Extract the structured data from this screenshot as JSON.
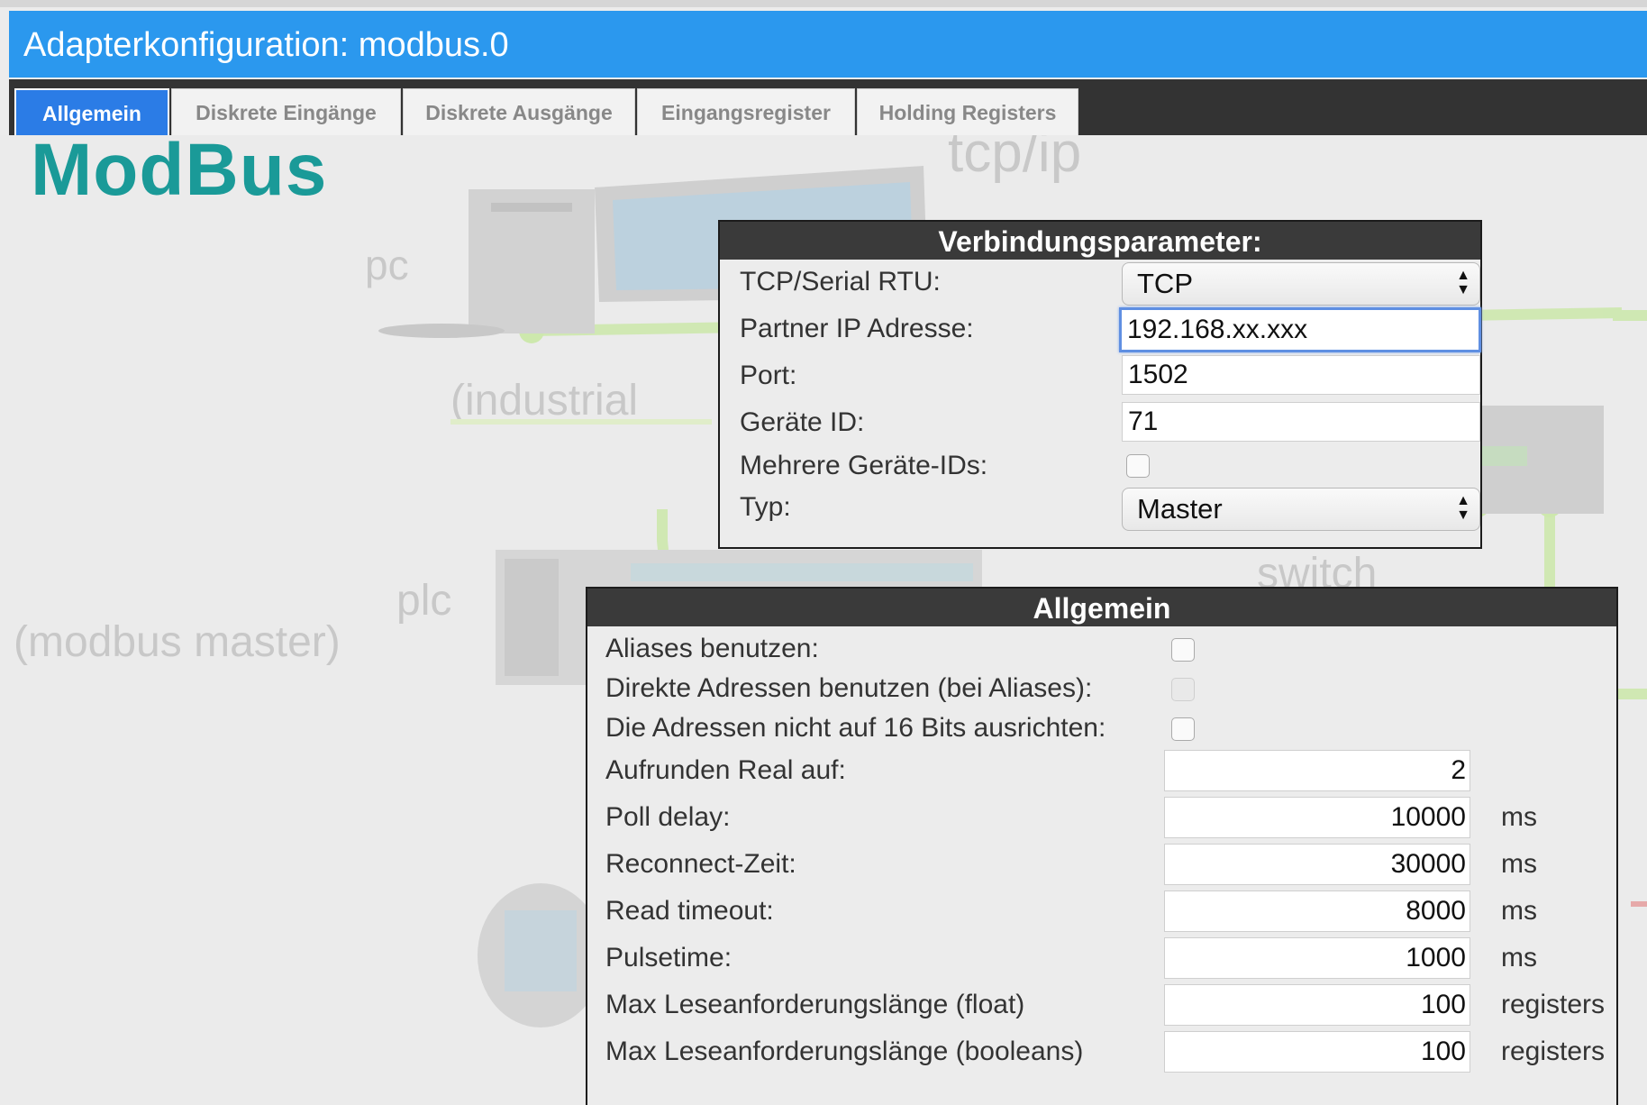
{
  "window": {
    "title": "Adapterkonfiguration: modbus.0"
  },
  "tabs": [
    {
      "label": "Allgemein",
      "active": true
    },
    {
      "label": "Diskrete Eingänge",
      "active": false
    },
    {
      "label": "Diskrete Ausgänge",
      "active": false
    },
    {
      "label": "Eingangsregister",
      "active": false
    },
    {
      "label": "Holding Registers",
      "active": false
    }
  ],
  "background": {
    "brand": "ModBus",
    "labels": {
      "tcpip": "tcp/ip",
      "pc": "pc",
      "industrial": "(industrial",
      "plc": "plc",
      "modbus_master": "(modbus master)",
      "switch": "switch"
    },
    "colors": {
      "brand": "#1a9a98",
      "network_line": "#c8e5a8"
    }
  },
  "connection": {
    "title": "Verbindungsparameter:",
    "mode": {
      "label": "TCP/Serial RTU:",
      "value": "TCP"
    },
    "ip": {
      "label": "Partner IP Adresse:",
      "value": "192.168.xx.xxx"
    },
    "port": {
      "label": "Port:",
      "value": "1502"
    },
    "device_id": {
      "label": "Geräte ID:",
      "value": "71"
    },
    "multi_ids": {
      "label": "Mehrere Geräte-IDs:",
      "checked": false
    },
    "type": {
      "label": "Typ:",
      "value": "Master"
    }
  },
  "general": {
    "title": "Allgemein",
    "aliases": {
      "label": "Aliases benutzen:",
      "checked": false
    },
    "direct_addresses": {
      "label": "Direkte Adressen benutzen (bei Aliases):",
      "checked": false,
      "disabled": true
    },
    "no_align": {
      "label": "Die Adressen nicht auf 16 Bits ausrichten:",
      "checked": false
    },
    "round_real": {
      "label": "Aufrunden Real auf:",
      "value": "2"
    },
    "poll_delay": {
      "label": "Poll delay:",
      "value": "10000",
      "unit": "ms"
    },
    "reconnect": {
      "label": "Reconnect-Zeit:",
      "value": "30000",
      "unit": "ms"
    },
    "read_timeout": {
      "label": "Read timeout:",
      "value": "8000",
      "unit": "ms"
    },
    "pulsetime": {
      "label": "Pulsetime:",
      "value": "1000",
      "unit": "ms"
    },
    "max_float": {
      "label": "Max Leseanforderungslänge (float)",
      "value": "100",
      "unit": "registers"
    },
    "max_bool": {
      "label": "Max Leseanforderungslänge (booleans)",
      "value": "100",
      "unit": "registers"
    }
  }
}
